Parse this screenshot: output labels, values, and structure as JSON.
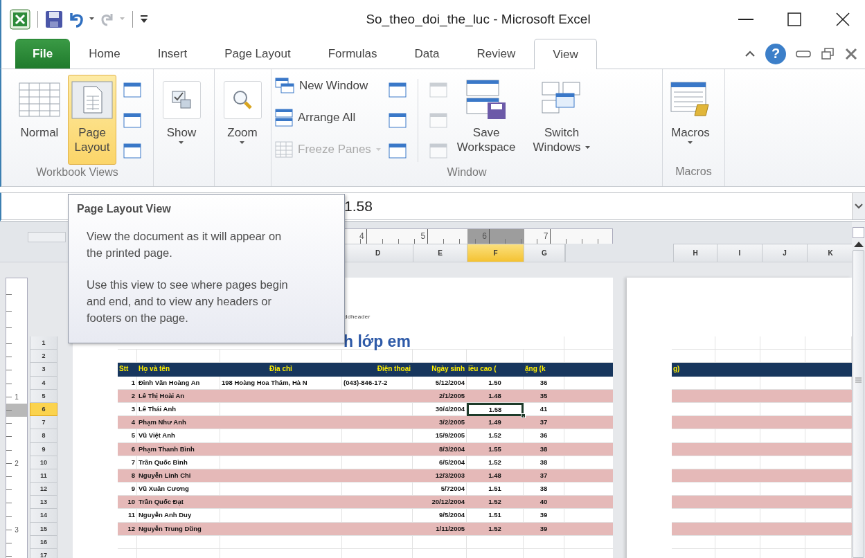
{
  "window": {
    "title": "So_theo_doi_the_luc - Microsoft Excel"
  },
  "tabs": [
    {
      "label": "File",
      "kind": "file",
      "selected": false
    },
    {
      "label": "Home",
      "kind": "tab",
      "selected": false
    },
    {
      "label": "Insert",
      "kind": "tab",
      "selected": false
    },
    {
      "label": "Page Layout",
      "kind": "tab",
      "selected": false
    },
    {
      "label": "Formulas",
      "kind": "tab",
      "selected": false
    },
    {
      "label": "Data",
      "kind": "tab",
      "selected": false
    },
    {
      "label": "Review",
      "kind": "tab",
      "selected": false
    },
    {
      "label": "View",
      "kind": "tab",
      "selected": true
    }
  ],
  "help": "?",
  "ribbon": {
    "groups": [
      {
        "label": "Workbook Views",
        "items": [
          {
            "kind": "large",
            "label": "Normal",
            "selected": false,
            "dropdown": false
          },
          {
            "kind": "large",
            "label": "Page Layout",
            "selected": true,
            "dropdown": false
          },
          {
            "kind": "icon-column",
            "icons": [
              {
                "disabled": false
              },
              {
                "disabled": false
              },
              {
                "disabled": false
              }
            ]
          }
        ]
      },
      {
        "items": [
          {
            "kind": "large",
            "label": "Show",
            "dropdown": true,
            "boxed": true
          }
        ]
      },
      {
        "items": [
          {
            "kind": "large",
            "label": "Zoom",
            "dropdown": true,
            "boxed": true
          }
        ]
      },
      {
        "label": "Window",
        "items": [
          {
            "kind": "rows",
            "rows": [
              {
                "label": "New Window",
                "disabled": false,
                "dropdown": false
              },
              {
                "label": "Arrange All",
                "disabled": false,
                "dropdown": false
              },
              {
                "label": "Freeze Panes",
                "disabled": true,
                "dropdown": true
              }
            ]
          },
          {
            "kind": "icon-column",
            "icons": [
              {
                "disabled": false
              },
              {
                "disabled": false
              },
              {
                "disabled": false
              }
            ]
          },
          {
            "kind": "icon-column",
            "icons": [
              {
                "disabled": true
              },
              {
                "disabled": true
              },
              {
                "disabled": true
              }
            ]
          },
          {
            "kind": "large",
            "label": "Save Workspace",
            "dropdown": false
          },
          {
            "kind": "large",
            "label": "Switch Windows",
            "dropdown": true
          }
        ]
      },
      {
        "label": "Macros",
        "items": [
          {
            "kind": "large",
            "label": "Macros",
            "dropdown": true
          }
        ]
      }
    ]
  },
  "formula_bar": {
    "value": "1.58"
  },
  "tooltip": {
    "title": "Page Layout View",
    "paragraphs": [
      "View the document as it will appear on the printed page.",
      "Use this view to see where pages begin and end, and to view any headers or footers on the page."
    ]
  },
  "ruler": {
    "labels": [
      "4",
      "5",
      "6",
      "7"
    ]
  },
  "column_headers": [
    {
      "label": "D",
      "selected": false
    },
    {
      "label": "E",
      "selected": false
    },
    {
      "label": "F",
      "selected": true
    },
    {
      "label": "G",
      "selected": false
    }
  ],
  "page2_column_headers": [
    {
      "label": "H",
      "selected": false
    },
    {
      "label": "I",
      "selected": false
    },
    {
      "label": "J",
      "selected": false
    },
    {
      "label": "K",
      "selected": false
    }
  ],
  "vertical_ruler": {
    "labels": [
      "1",
      "2",
      "3"
    ]
  },
  "row_headers": [
    {
      "label": "1",
      "selected": false
    },
    {
      "label": "2",
      "selected": false
    },
    {
      "label": "3",
      "selected": false
    },
    {
      "label": "4",
      "selected": false
    },
    {
      "label": "5",
      "selected": false
    },
    {
      "label": "6",
      "selected": true
    },
    {
      "label": "7",
      "selected": false
    },
    {
      "label": "8",
      "selected": false
    },
    {
      "label": "9",
      "selected": false
    },
    {
      "label": "10",
      "selected": false
    },
    {
      "label": "11",
      "selected": false
    },
    {
      "label": "12",
      "selected": false
    },
    {
      "label": "13",
      "selected": false
    },
    {
      "label": "14",
      "selected": false
    },
    {
      "label": "15",
      "selected": false
    },
    {
      "label": "16",
      "selected": false
    },
    {
      "label": "17",
      "selected": false
    }
  ],
  "page1": {
    "header_text": "ddheader",
    "title": "h lớp em",
    "table": {
      "columns": [
        "Stt",
        "Họ và tên",
        "Địa chỉ",
        "Điện thoại",
        "Ngày sinh",
        "iều cao (",
        "ặng (k"
      ],
      "rows": [
        {
          "shaded": false,
          "cells": [
            "1",
            "Đinh Văn Hoàng An",
            "198 Hoàng Hoa Thám, Hà N",
            "(043)-846-17-2",
            "5/12/2004",
            "1.50",
            "36"
          ]
        },
        {
          "shaded": true,
          "cells": [
            "2",
            "Lê Thị Hoài An",
            "",
            "",
            "2/1/2005",
            "1.48",
            "35"
          ]
        },
        {
          "shaded": false,
          "cells": [
            "3",
            "Lê Thái Anh",
            "",
            "",
            "30/4/2004",
            "1.58",
            "41"
          ]
        },
        {
          "shaded": true,
          "cells": [
            "4",
            "Phạm Như Anh",
            "",
            "",
            "3/2/2005",
            "1.49",
            "37"
          ]
        },
        {
          "shaded": false,
          "cells": [
            "5",
            "Vũ Việt Anh",
            "",
            "",
            "15/9/2005",
            "1.52",
            "36"
          ]
        },
        {
          "shaded": true,
          "cells": [
            "6",
            "Phạm Thanh Bình",
            "",
            "",
            "8/3/2004",
            "1.55",
            "38"
          ]
        },
        {
          "shaded": false,
          "cells": [
            "7",
            "Trần Quốc Bình",
            "",
            "",
            "6/5/2004",
            "1.52",
            "38"
          ]
        },
        {
          "shaded": true,
          "cells": [
            "8",
            "Nguyễn Linh Chi",
            "",
            "",
            "12/3/2003",
            "1.48",
            "37"
          ]
        },
        {
          "shaded": false,
          "cells": [
            "9",
            "Vũ Xuân Cương",
            "",
            "",
            "5/72004",
            "1.51",
            "38"
          ]
        },
        {
          "shaded": true,
          "cells": [
            "10",
            "Trần Quốc Đạt",
            "",
            "",
            "20/12/2004",
            "1.52",
            "40"
          ]
        },
        {
          "shaded": false,
          "cells": [
            "11",
            "Nguyễn Anh Duy",
            "",
            "",
            "9/5/2004",
            "1.51",
            "39"
          ]
        },
        {
          "shaded": true,
          "cells": [
            "12",
            "Nguyễn Trung Dũng",
            "",
            "",
            "1/11/2005",
            "1.52",
            "39"
          ]
        }
      ]
    }
  },
  "page2": {
    "header_text": "g)"
  }
}
